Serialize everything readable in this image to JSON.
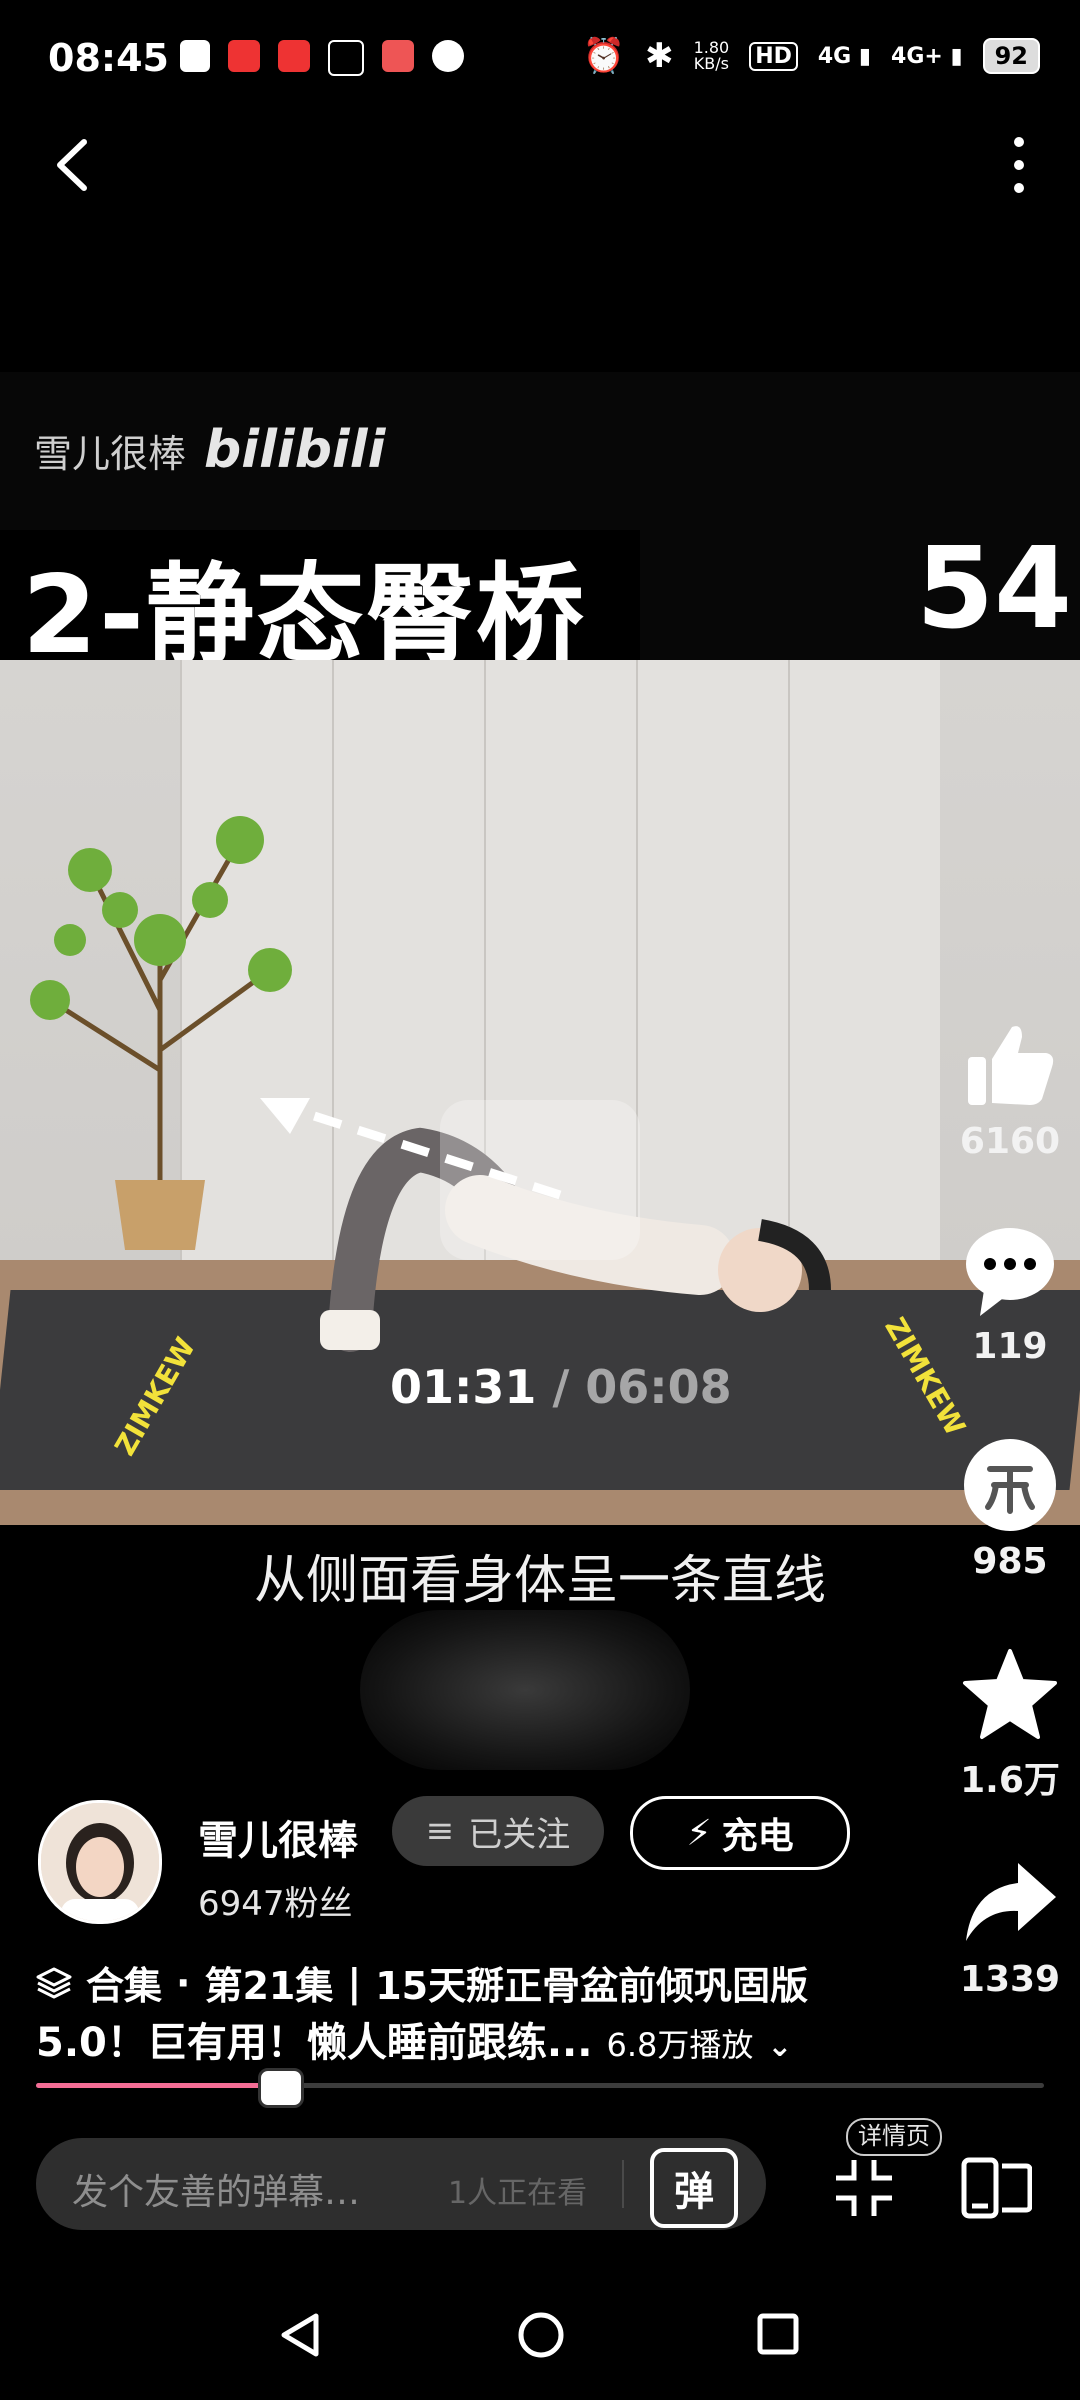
{
  "status_bar": {
    "time": "08:45",
    "net_speed": "1.80\nKB/s",
    "battery": "92"
  },
  "video": {
    "watermark_author": "雪儿很棒",
    "watermark_logo": "bilibili",
    "title": "2-静态臀桥",
    "count": "54",
    "mat_text": "ZIMKEW",
    "time_current": "01:31",
    "time_total": " / 06:08",
    "subtitle": "从侧面看身体呈一条直线",
    "progress": 0.24
  },
  "actions": {
    "like_count": "6160",
    "comment_count": "119",
    "coin_count": "985",
    "favorite_count": "1.6万",
    "share_count": "1339"
  },
  "author": {
    "name": "雪儿很棒",
    "fans": "6947粉丝",
    "follow_label": "已关注",
    "charge_label": "充电"
  },
  "description": {
    "collection_label": "合集",
    "separator": "·",
    "episode": "第21集",
    "divider": "|",
    "line1_title": "15天掰正骨盆前倾巩固版",
    "line2_title": "5.0！巨有用！懒人睡前跟练...",
    "plays": "6.8万播放"
  },
  "bottom_bar": {
    "danmaku_placeholder": "发个友善的弹幕…",
    "watching": "1人正在看",
    "danmaku_button": "弹",
    "detail_label": "详情页"
  },
  "colors": {
    "accent": "#f36d95",
    "background": "#000000"
  }
}
